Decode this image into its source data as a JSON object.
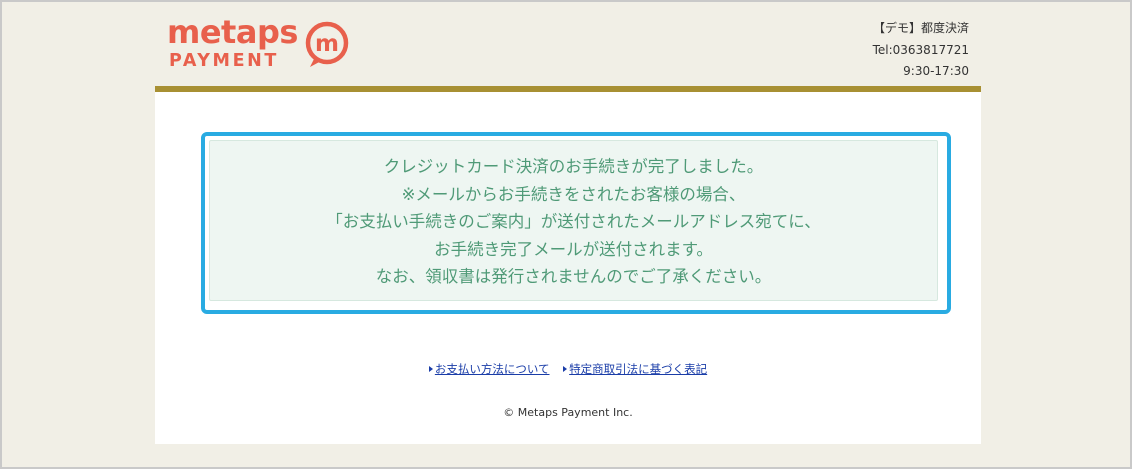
{
  "header": {
    "logo_word": "metaps",
    "logo_sub": "PAYMENT",
    "logo_mark_letter": "m",
    "logo_mark_icon": "speech-bubble-m-icon",
    "contact_name": "【デモ】都度決済",
    "contact_tel": "Tel:0363817721",
    "contact_hours": "9:30-17:30"
  },
  "notice": {
    "lines": [
      "クレジットカード決済のお手続きが完了しました。",
      "※メールからお手続きをされたお客様の場合、",
      "「お支払い手続きのご案内」が送付されたメールアドレス宛てに、",
      "お手続き完了メールが送付されます。",
      "なお、領収書は発行されませんのでご了承ください。"
    ]
  },
  "footer": {
    "links": [
      {
        "label": "お支払い方法について",
        "icon": "triangle-right-icon"
      },
      {
        "label": "特定商取引法に基づく表記",
        "icon": "triangle-right-icon"
      }
    ],
    "copyright": "© Metaps Payment Inc."
  },
  "colors": {
    "brand": "#e8604c",
    "header_bg": "#f1efe6",
    "header_rule": "#a89033",
    "notice_border": "#29abe2",
    "notice_bg": "#eef6f2",
    "notice_text": "#4f9a77",
    "link": "#1a3da8"
  }
}
